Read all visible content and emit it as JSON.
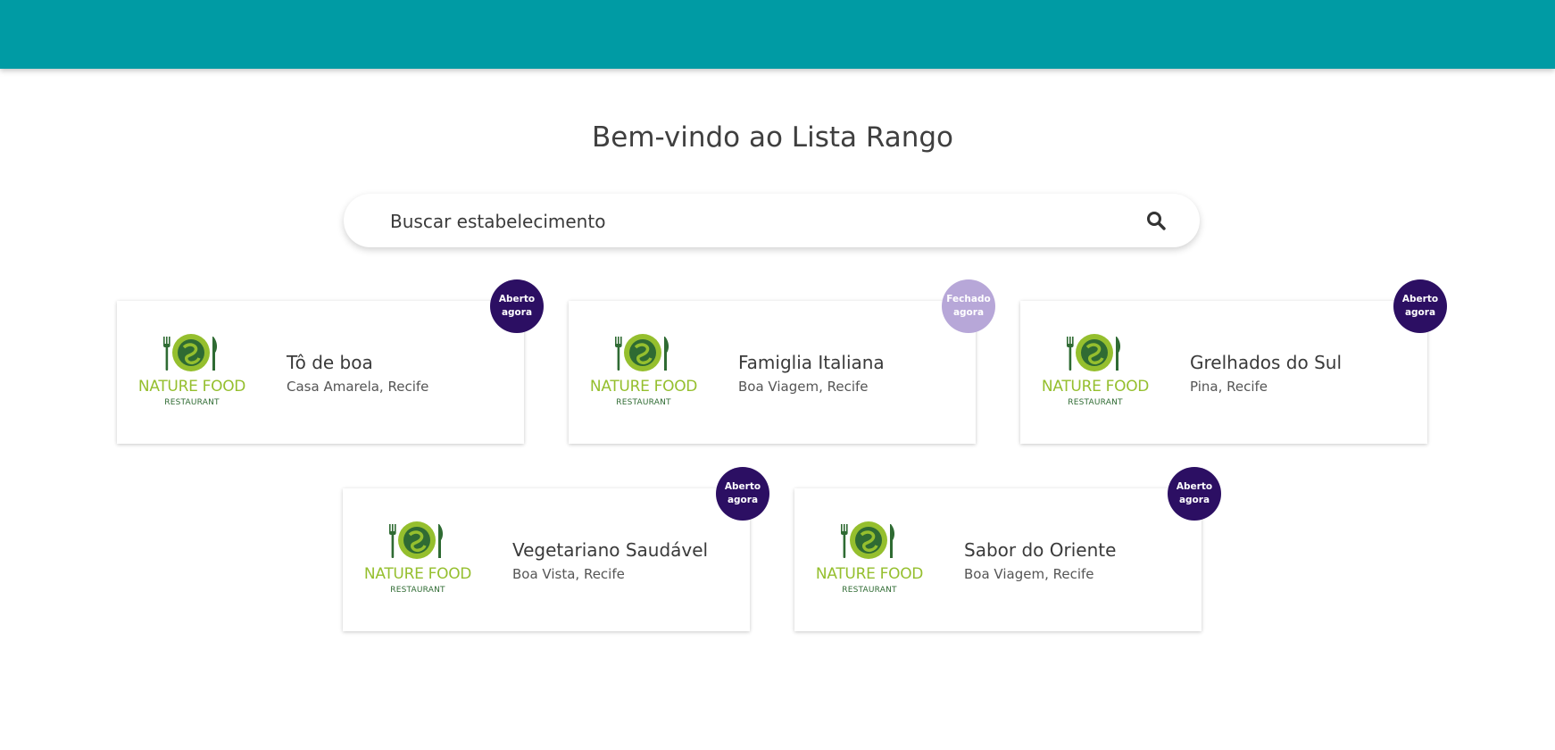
{
  "header": {
    "color": "#009ba4"
  },
  "page": {
    "title": "Bem-vindo ao Lista Rango"
  },
  "search": {
    "placeholder": "Buscar estabelecimento",
    "icon": "search-icon"
  },
  "logo": {
    "brand": "NATURE FOOD",
    "sub": "RESTAURANT"
  },
  "colors": {
    "open_badge": "#2c0f63",
    "closed_badge": "#b7a7d8",
    "brand_green": "#95bf2e"
  },
  "restaurants": [
    {
      "name": "Tô de boa",
      "location": "Casa Amarela, Recife",
      "status_line1": "Aberto",
      "status_line2": "agora",
      "open": true
    },
    {
      "name": "Famiglia Italiana",
      "location": "Boa Viagem, Recife",
      "status_line1": "Fechado",
      "status_line2": "agora",
      "open": false
    },
    {
      "name": "Grelhados do Sul",
      "location": "Pina, Recife",
      "status_line1": "Aberto",
      "status_line2": "agora",
      "open": true
    },
    {
      "name": "Vegetariano Saudável",
      "location": "Boa Vista, Recife",
      "status_line1": "Aberto",
      "status_line2": "agora",
      "open": true
    },
    {
      "name": "Sabor do Oriente",
      "location": "Boa Viagem, Recife",
      "status_line1": "Aberto",
      "status_line2": "agora",
      "open": true
    }
  ]
}
